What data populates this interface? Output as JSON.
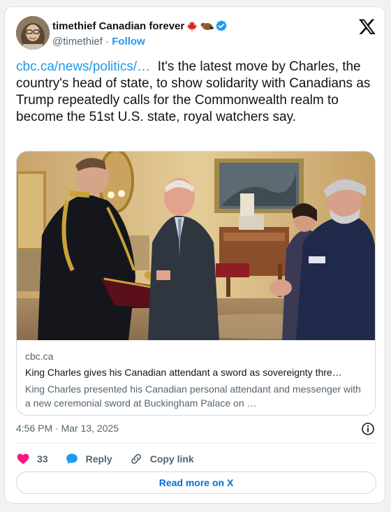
{
  "author": {
    "display_name": "timethief Canadian forever",
    "handle": "@timethief",
    "separator": "·",
    "follow_label": "Follow",
    "icons": [
      "maple-leaf-icon",
      "beaver-icon",
      "verified-badge-icon"
    ]
  },
  "tweet": {
    "link_text": "cbc.ca/news/politics/…",
    "text": "It's the latest move by Charles, the country's head of state, to show solidarity with Canadians as Trump repeatedly calls for the Commonwealth realm to become the 51st U.S. state, royal watchers say."
  },
  "link_card": {
    "domain": "cbc.ca",
    "title": "King Charles gives his Canadian attendant a sword as sovereignty thre…",
    "description": "King Charles presented his Canadian personal attendant and messenger with a new ceremonial sword at Buckingham Palace on …"
  },
  "meta": {
    "timestamp": "4:56 PM · Mar 13, 2025"
  },
  "actions": {
    "like_count": "33",
    "reply_label": "Reply",
    "copy_link_label": "Copy link"
  },
  "footer": {
    "read_more_label": "Read more on X"
  },
  "colors": {
    "accent": "#1d9bf0",
    "like": "#f91880",
    "verified": "#1d9bf0",
    "read_more": "#006fd6"
  }
}
